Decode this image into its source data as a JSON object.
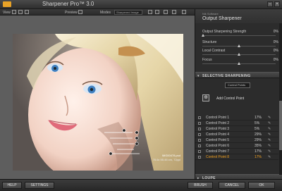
{
  "app": {
    "title": "Sharpener Pro™ 3.0"
  },
  "toolbar": {
    "view_label": "View",
    "preview_label": "Preview",
    "modes_label": "Modes",
    "modes_value": "Sharpened Image"
  },
  "image": {
    "file_name": "IMG00478.psd",
    "file_info": "76.6x 55.46 cm, 72ppi"
  },
  "panel": {
    "brand": "Nik Software",
    "title": "Output Sharpener",
    "sliders": [
      {
        "label": "Output Sharpening Strength",
        "value": "0%",
        "level": 0
      },
      {
        "label": "Structure",
        "value": "0%",
        "level": 0.5
      },
      {
        "label": "Local Contrast",
        "value": "0%",
        "level": 0.5
      },
      {
        "label": "Focus",
        "value": "0%",
        "level": 0.5
      }
    ],
    "selective_label": "SELECTIVE SHARPENING",
    "control_dropdown": "Control Points",
    "add_control_point": "Add Control Point",
    "control_points": [
      {
        "name": "Control Point 1",
        "pct": "17%",
        "selected": false
      },
      {
        "name": "Control Point 2",
        "pct": "5%",
        "selected": false
      },
      {
        "name": "Control Point 3",
        "pct": "5%",
        "selected": false
      },
      {
        "name": "Control Point 4",
        "pct": "29%",
        "selected": false
      },
      {
        "name": "Control Point 5",
        "pct": "29%",
        "selected": false
      },
      {
        "name": "Control Point 6",
        "pct": "35%",
        "selected": false
      },
      {
        "name": "Control Point 7",
        "pct": "17%",
        "selected": false
      },
      {
        "name": "Control Point 8",
        "pct": "17%",
        "selected": true
      }
    ],
    "loupe_label": "LOUPE"
  },
  "footer": {
    "help": "HELP",
    "settings": "SETTINGS",
    "brush": "BRUSH",
    "cancel": "CANCEL",
    "ok": "OK"
  },
  "colors": {
    "accent": "#e8a227",
    "selected_text": "#f0a020"
  }
}
